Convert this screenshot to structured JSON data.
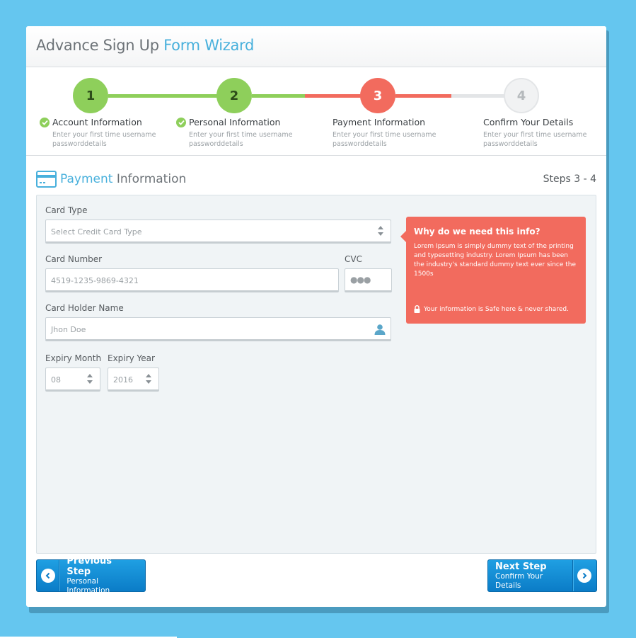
{
  "header": {
    "title_main": "Advance Sign Up ",
    "title_accent": "Form Wizard"
  },
  "steps": [
    {
      "number": "1",
      "title": "Account Information",
      "sub": "Enter your first time username passworddetails",
      "state": "done"
    },
    {
      "number": "2",
      "title": "Personal Information",
      "sub": "Enter your first time username passworddetails",
      "state": "done"
    },
    {
      "number": "3",
      "title": "Payment Information",
      "sub": "Enter your first time username passworddetails",
      "state": "active"
    },
    {
      "number": "4",
      "title": "Confirm Your Details",
      "sub": "Enter your first time username passworddetails",
      "state": "todo"
    }
  ],
  "section": {
    "title_accent": "Payment",
    "title_rest": " Information",
    "steps": "Steps 3 - 4",
    "icon": "credit-card-icon"
  },
  "form": {
    "card_type": {
      "label": "Card Type",
      "value": "Select Credit Card Type"
    },
    "card_number": {
      "label": "Card Number",
      "value": "4519-1235-9869-4321"
    },
    "cvc": {
      "label": "CVC",
      "value": "●●●"
    },
    "holder": {
      "label": "Card Holder Name",
      "value": "Jhon Doe",
      "icon": "user-icon"
    },
    "expiry_month": {
      "label": "Expiry Month",
      "value": "08"
    },
    "expiry_year": {
      "label": "Expiry Year",
      "value": "2016"
    }
  },
  "info": {
    "title": "Why do we need this info?",
    "text": "Lorem Ipsum is simply dummy text of the printing and typesetting industry. Lorem Ipsum has been the industry's standard dummy text ever since the 1500s",
    "safe": "Your information is Safe here & never shared.",
    "icon": "lock-icon"
  },
  "buttons": {
    "prev": {
      "main": "Previous Step",
      "sub": "Personal Information",
      "icon": "chevron-left-icon"
    },
    "next": {
      "main": "Next Step",
      "sub": "Confirm Your Details",
      "icon": "chevron-right-icon"
    }
  },
  "colors": {
    "background": "#65c6ef",
    "accent": "#48b0dc",
    "done": "#8ecf5b",
    "active": "#f26b5e",
    "button": "#1f9fe2"
  }
}
